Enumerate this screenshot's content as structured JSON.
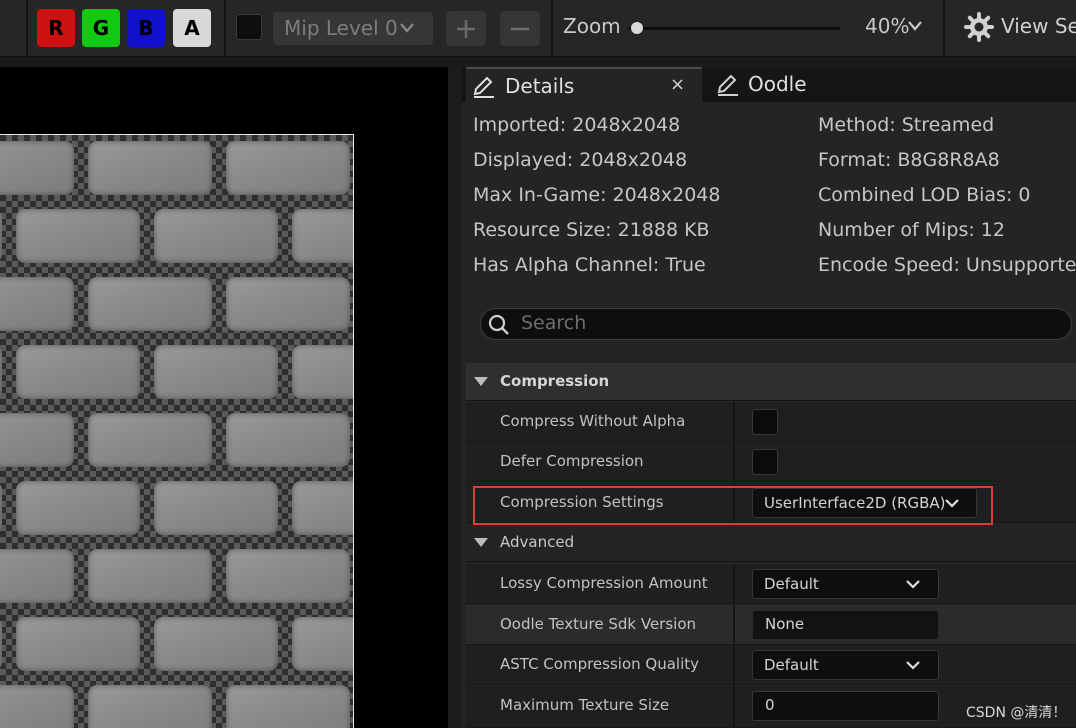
{
  "toolbar": {
    "channels": [
      {
        "label": "R",
        "color": "#cc1111"
      },
      {
        "label": "G",
        "color": "#11c911"
      },
      {
        "label": "B",
        "color": "#1111cc"
      },
      {
        "label": "A",
        "color": "#d8d8d8"
      }
    ],
    "mip_label": "Mip Level 0",
    "zoom_label": "Zoom",
    "zoom_value": "40%",
    "zoom_slider_fraction": 0.02,
    "view_settings_label": "View Set"
  },
  "tabs": {
    "details": "Details",
    "close": "×",
    "oodle": "Oodle"
  },
  "stats": {
    "left": [
      "Imported: 2048x2048",
      "Displayed: 2048x2048",
      "Max In-Game: 2048x2048",
      "Resource Size: 21888 KB",
      "Has Alpha Channel: True"
    ],
    "right": [
      "Method: Streamed",
      "Format: B8G8R8A8",
      "Combined LOD Bias: 0",
      "Number of Mips: 12",
      "Encode Speed: Unsupported"
    ]
  },
  "search": {
    "placeholder": "Search"
  },
  "compression": {
    "title": "Compression",
    "compress_without_alpha": "Compress Without Alpha",
    "defer_compression": "Defer Compression",
    "compression_settings": "Compression Settings",
    "compression_settings_value": "UserInterface2D (RGBA)"
  },
  "advanced": {
    "title": "Advanced",
    "lossy_label": "Lossy Compression Amount",
    "lossy_value": "Default",
    "oodle_label": "Oodle Texture Sdk Version",
    "oodle_value": "None",
    "astc_label": "ASTC Compression Quality",
    "astc_value": "Default",
    "max_size_label": "Maximum Texture Size",
    "max_size_value": "0"
  },
  "watermark": "CSDN @清清！"
}
